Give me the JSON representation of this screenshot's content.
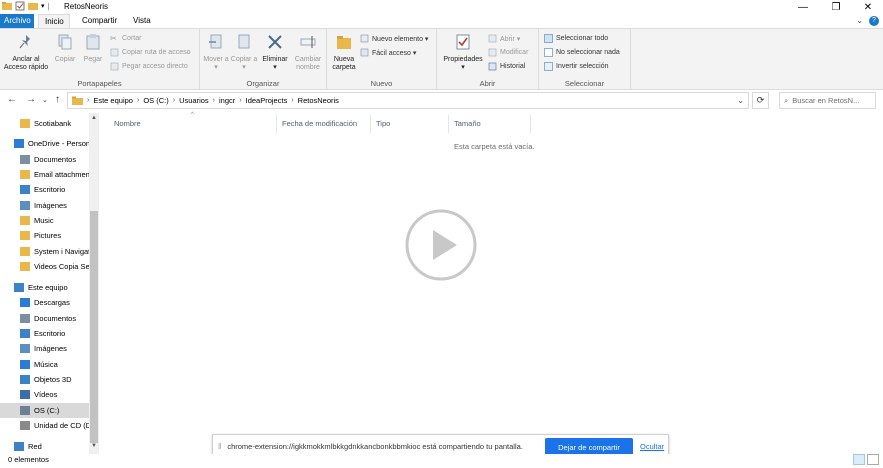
{
  "window": {
    "title": "RetosNeoris",
    "minimize": "—",
    "restore": "❐",
    "close": "✕"
  },
  "tabs": {
    "file": "Archivo",
    "home": "Inicio",
    "share": "Compartir",
    "view": "Vista"
  },
  "ribbon": {
    "clipboard": {
      "group_label": "Portapapeles",
      "pin": "Anclar al Acceso rápido",
      "copy": "Copiar",
      "paste": "Pegar",
      "cut": "Cortar",
      "copy_path": "Copiar ruta de acceso",
      "paste_shortcut": "Pegar acceso directo"
    },
    "organize": {
      "group_label": "Organizar",
      "move": "Mover a ▾",
      "copy_to": "Copiar a ▾",
      "delete": "Eliminar ▾",
      "rename": "Cambiar nombre"
    },
    "new": {
      "group_label": "Nuevo",
      "new_folder": "Nueva carpeta",
      "new_item": "Nuevo elemento ▾",
      "easy_access": "Fácil acceso ▾"
    },
    "open": {
      "group_label": "Abrir",
      "properties": "Propiedades ▾",
      "open": "Abrir ▾",
      "edit": "Modificar",
      "history": "Historial"
    },
    "select": {
      "group_label": "Seleccionar",
      "select_all": "Seleccionar todo",
      "select_none": "No seleccionar nada",
      "invert": "Invertir selección"
    }
  },
  "address": {
    "crumbs": [
      "Este equipo",
      "OS (C:)",
      "Usuarios",
      "ingcr",
      "IdeaProjects",
      "RetosNeoris"
    ],
    "search_placeholder": "Buscar en RetosN..."
  },
  "sidebar": {
    "items": [
      {
        "label": "Scotiabank",
        "icon": "folder-icon"
      },
      {
        "label": "OneDrive - Person",
        "icon": "cloud-icon"
      },
      {
        "label": "Documentos",
        "icon": "documents-icon"
      },
      {
        "label": "Email attachmen",
        "icon": "folder-icon"
      },
      {
        "label": "Escritorio",
        "icon": "desktop-icon"
      },
      {
        "label": "Imágenes",
        "icon": "pictures-icon"
      },
      {
        "label": "Music",
        "icon": "folder-icon"
      },
      {
        "label": "Pictures",
        "icon": "folder-icon"
      },
      {
        "label": "System i Navigat",
        "icon": "folder-icon"
      },
      {
        "label": "Videos Copia Seg",
        "icon": "folder-icon"
      },
      {
        "label": "Este equipo",
        "icon": "computer-icon"
      },
      {
        "label": "Descargas",
        "icon": "downloads-icon"
      },
      {
        "label": "Documentos",
        "icon": "documents-icon"
      },
      {
        "label": "Escritorio",
        "icon": "desktop-icon"
      },
      {
        "label": "Imágenes",
        "icon": "pictures-icon"
      },
      {
        "label": "Música",
        "icon": "music-icon"
      },
      {
        "label": "Objetos 3D",
        "icon": "objects3d-icon"
      },
      {
        "label": "Vídeos",
        "icon": "videos-icon"
      },
      {
        "label": "OS (C:)",
        "icon": "drive-icon"
      },
      {
        "label": "Unidad de CD (D",
        "icon": "cd-drive-icon"
      },
      {
        "label": "Red",
        "icon": "network-icon"
      }
    ]
  },
  "columns": {
    "name": "Nombre",
    "modified": "Fecha de modificación",
    "type": "Tipo",
    "size": "Tamaño"
  },
  "empty_message": "Esta carpeta está vacía.",
  "status": {
    "count": "0 elementos"
  },
  "share_banner": {
    "message": "chrome-extension://igkkmokkmlbkkgdnkkancbonkbbmkioc está compartiendo tu pantalla.",
    "stop_label": "Dejar de compartir",
    "hide_label": "Ocultar"
  },
  "colors": {
    "accent": "#1979ca",
    "folder": "#e8b84a",
    "share_button": "#1a73e8"
  }
}
